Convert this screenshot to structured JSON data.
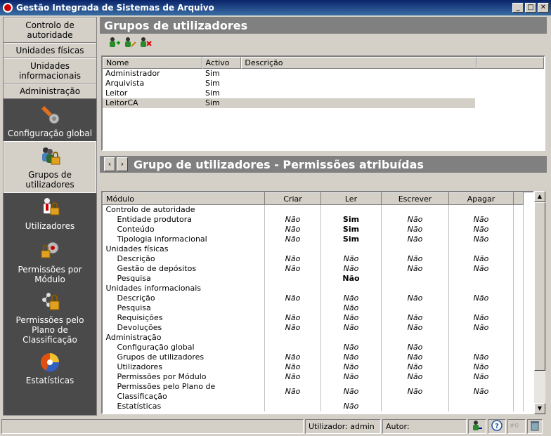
{
  "window": {
    "title": "Gestão Integrada de Sistemas de Arquivo",
    "min": "_",
    "max": "□",
    "close": "✕"
  },
  "sidebar": {
    "nav": [
      "Controlo de autoridade",
      "Unidades físicas",
      "Unidades informacionais",
      "Administração"
    ],
    "tools": [
      {
        "label": "Configuração global",
        "icon": "wrench-gear-icon"
      },
      {
        "label": "Grupos de utilizadores",
        "icon": "user-group-lock-icon"
      },
      {
        "label": "Utilizadores",
        "icon": "user-lock-icon"
      },
      {
        "label": "Permissões por Módulo",
        "icon": "module-permissions-icon"
      },
      {
        "label": "Permissões pelo Plano de Classificação",
        "icon": "classification-permissions-icon"
      },
      {
        "label": "Estatísticas",
        "icon": "pie-chart-icon"
      }
    ]
  },
  "panel1": {
    "title": "Grupos de utilizadores",
    "columns": [
      "Nome",
      "Activo",
      "Descrição"
    ],
    "rows": [
      {
        "nome": "Administrador",
        "activo": "Sim",
        "descricao": ""
      },
      {
        "nome": "Arquivista",
        "activo": "Sim",
        "descricao": ""
      },
      {
        "nome": "Leitor",
        "activo": "Sim",
        "descricao": ""
      },
      {
        "nome": "LeitorCA",
        "activo": "Sim",
        "descricao": ""
      }
    ],
    "selected_row": 3
  },
  "panel2": {
    "title": "Grupo de utilizadores - Permissões atribuídas",
    "prev": "‹",
    "next": "›",
    "columns": [
      "Módulo",
      "Criar",
      "Ler",
      "Escrever",
      "Apagar"
    ],
    "rows": [
      {
        "m": "Controlo de autoridade",
        "g": true,
        "c": "",
        "l": "",
        "e": "",
        "a": ""
      },
      {
        "m": "Entidade produtora",
        "c": "Não",
        "l": "Sim",
        "e": "Não",
        "a": "Não"
      },
      {
        "m": "Conteúdo",
        "c": "Não",
        "l": "Sim",
        "e": "Não",
        "a": "Não"
      },
      {
        "m": "Tipologia informacional",
        "c": "Não",
        "l": "Sim",
        "e": "Não",
        "a": "Não"
      },
      {
        "m": "Unidades físicas",
        "g": true,
        "c": "",
        "l": "",
        "e": "",
        "a": ""
      },
      {
        "m": "Descrição",
        "c": "Não",
        "l": "Não",
        "e": "Não",
        "a": "Não"
      },
      {
        "m": "Gestão de depósitos",
        "c": "Não",
        "l": "Não",
        "e": "Não",
        "a": "Não"
      },
      {
        "m": "Pesquisa",
        "c": "",
        "l": "Não",
        "e": "",
        "a": "",
        "lb": true
      },
      {
        "m": "Unidades informacionais",
        "g": true,
        "c": "",
        "l": "",
        "e": "",
        "a": ""
      },
      {
        "m": "Descrição",
        "c": "Não",
        "l": "Não",
        "e": "Não",
        "a": "Não"
      },
      {
        "m": "Pesquisa",
        "c": "",
        "l": "Não",
        "e": "",
        "a": ""
      },
      {
        "m": "Requisições",
        "c": "Não",
        "l": "Não",
        "e": "Não",
        "a": "Não"
      },
      {
        "m": "Devoluções",
        "c": "Não",
        "l": "Não",
        "e": "Não",
        "a": "Não"
      },
      {
        "m": "Administração",
        "g": true,
        "c": "",
        "l": "",
        "e": "",
        "a": ""
      },
      {
        "m": "Configuração global",
        "c": "",
        "l": "Não",
        "e": "Não",
        "a": ""
      },
      {
        "m": "Grupos de utilizadores",
        "c": "Não",
        "l": "Não",
        "e": "Não",
        "a": "Não"
      },
      {
        "m": "Utilizadores",
        "c": "Não",
        "l": "Não",
        "e": "Não",
        "a": "Não"
      },
      {
        "m": "Permissões por Módulo",
        "c": "Não",
        "l": "Não",
        "e": "Não",
        "a": "Não"
      },
      {
        "m": "Permissões pelo Plano de Classificação",
        "c": "Não",
        "l": "Não",
        "e": "Não",
        "a": "Não"
      },
      {
        "m": "Estatísticas",
        "c": "",
        "l": "Não",
        "e": "",
        "a": ""
      }
    ]
  },
  "status": {
    "user": "Utilizador: admin",
    "author": "Autor:",
    "count": "#0"
  },
  "colors": {
    "header_gray": "#808080",
    "sidebar_dark": "#4a4a4a",
    "face": "#d4d0c8"
  }
}
